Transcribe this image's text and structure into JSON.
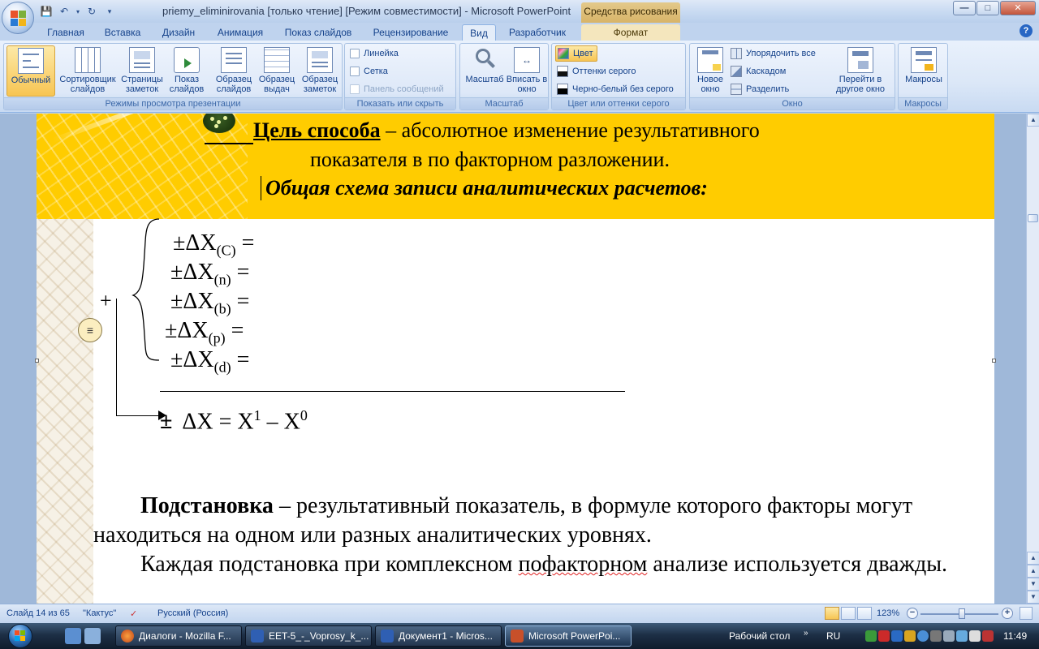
{
  "window": {
    "title": "priemy_eliminirovania [только чтение] [Режим совместимости] - Microsoft PowerPoint",
    "contextual_tab_group": "Средства рисования"
  },
  "tabs": [
    "Главная",
    "Вставка",
    "Дизайн",
    "Анимация",
    "Показ слайдов",
    "Рецензирование",
    "Вид",
    "Разработчик",
    "Формат"
  ],
  "active_tab": "Вид",
  "ribbon": {
    "views": {
      "label": "Режимы просмотра презентации",
      "buttons": [
        {
          "label": "Обычный"
        },
        {
          "label": "Сортировщик слайдов"
        },
        {
          "label": "Страницы заметок"
        },
        {
          "label": "Показ слайдов"
        },
        {
          "label": "Образец слайдов"
        },
        {
          "label": "Образец выдач"
        },
        {
          "label": "Образец заметок"
        }
      ]
    },
    "show_hide": {
      "label": "Показать или скрыть",
      "items": [
        {
          "label": "Линейка",
          "checked": false,
          "enabled": true
        },
        {
          "label": "Сетка",
          "checked": false,
          "enabled": true
        },
        {
          "label": "Панель сообщений",
          "checked": false,
          "enabled": false
        }
      ]
    },
    "zoom": {
      "label": "Масштаб",
      "buttons": [
        {
          "label": "Масштаб"
        },
        {
          "label": "Вписать в окно"
        }
      ]
    },
    "color": {
      "label": "Цвет или оттенки серого",
      "items": [
        {
          "label": "Цвет",
          "selected": true
        },
        {
          "label": "Оттенки серого",
          "selected": false
        },
        {
          "label": "Черно-белый без серого",
          "selected": false
        }
      ]
    },
    "window": {
      "label": "Окно",
      "new_window": "Новое окно",
      "items": [
        "Упорядочить все",
        "Каскадом",
        "Разделить"
      ],
      "switch": "Перейти в другое окно"
    },
    "macros": {
      "label": "Макросы",
      "button": "Макросы"
    }
  },
  "slide": {
    "goal_term": "Цель способа",
    "goal_rest_1": " – абсолютное изменение результативного",
    "goal_line_2": "показателя в по факторном разложении.",
    "scheme": "Общая схема записи аналитических расчетов:",
    "formulas": [
      {
        "sign": "±ΔX",
        "sub": "(C)",
        "eq": " ="
      },
      {
        "sign": "±ΔX",
        "sub": "(n)",
        "eq": " ="
      },
      {
        "sign": "±ΔX",
        "sub": "(b)",
        "eq": " ="
      },
      {
        "sign": "±ΔX",
        "sub": "(p)",
        "eq": " ="
      },
      {
        "sign": "±ΔX",
        "sub": "(d)",
        "eq": " ="
      }
    ],
    "plus": "+",
    "equals_bullet": "≡",
    "total": {
      "pm": "±",
      "delta": "ΔX = X",
      "sup1": "1",
      "minus": " – X",
      "sup0": "0"
    },
    "p1_bold": "Подстановка",
    "p1_rest": " – результативный показатель, в формуле которого факторы могут находиться на одном или разных аналитических уровнях.",
    "p2_a": "Каждая подстановка при комплексном ",
    "p2_misspelled": "пофакторном",
    "p2_b": " анализе используется дважды."
  },
  "status_bar": {
    "slide": "Слайд 14 из 65",
    "theme": "\"Кактус\"",
    "language": "Русский (Россия)",
    "zoom": "123%",
    "zoom_fraction": 0.53
  },
  "taskbar": {
    "tasks": [
      {
        "label": "Диалоги - Mozilla F...",
        "color": "#e66a1e"
      },
      {
        "label": "EET-5_-_Voprosy_k_...",
        "color": "#2f5fb3"
      },
      {
        "label": "Документ1 - Micros...",
        "color": "#2f5fb3"
      },
      {
        "label": "Microsoft PowerPoi...",
        "color": "#c8502a"
      }
    ],
    "active_task": 3,
    "desktop": "Рабочий стол",
    "lang": "RU",
    "clock": "11:49"
  },
  "colors": {
    "slide_header": "#ffcc00",
    "ribbon_selected": "#f7c553"
  }
}
